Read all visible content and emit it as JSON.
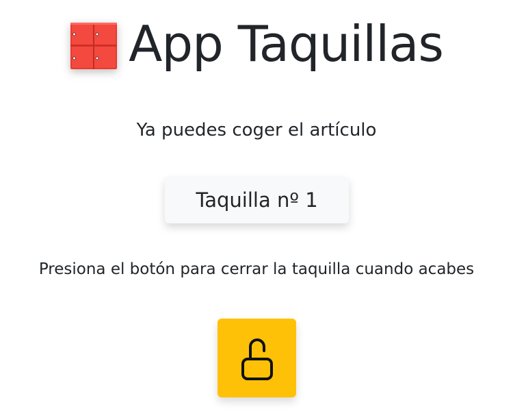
{
  "header": {
    "title": "App Taquillas",
    "logo_icon": "lockers-icon",
    "logo_color": "#f4493f"
  },
  "main": {
    "message": "Ya puedes coger el artículo",
    "locker_label": "Taquilla nº 1",
    "instruction": "Presiona el botón para cerrar la taquilla cuando acabes",
    "lock_button": {
      "icon": "unlocked-padlock-icon",
      "color": "#ffc107"
    }
  }
}
